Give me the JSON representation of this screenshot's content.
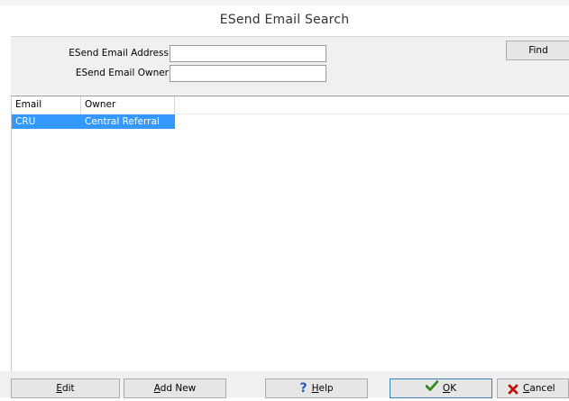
{
  "window": {
    "title": "ESend Email Search"
  },
  "search": {
    "address_label": "ESend Email Address",
    "address_value": "",
    "owner_label": "ESend Email Owner",
    "owner_value": "",
    "find_label": "Find"
  },
  "grid": {
    "columns": [
      "Email Address",
      "Owner"
    ],
    "rows": [
      {
        "email": "CRU",
        "owner": "Central Referral Unit",
        "selected": true
      }
    ]
  },
  "buttons": {
    "edit": {
      "mnemonic": "E",
      "rest": "dit"
    },
    "add_new": {
      "mnemonic": "A",
      "rest": "dd New"
    },
    "help": {
      "mnemonic": "H",
      "rest": "elp"
    },
    "ok": {
      "mnemonic": "O",
      "rest": "K"
    },
    "cancel": {
      "mnemonic": "C",
      "rest": "ancel"
    }
  },
  "colors": {
    "selection": "#3399ff",
    "help_icon": "#1e5bb8",
    "ok_icon": "#2f8a1f",
    "cancel_icon": "#c41010"
  }
}
